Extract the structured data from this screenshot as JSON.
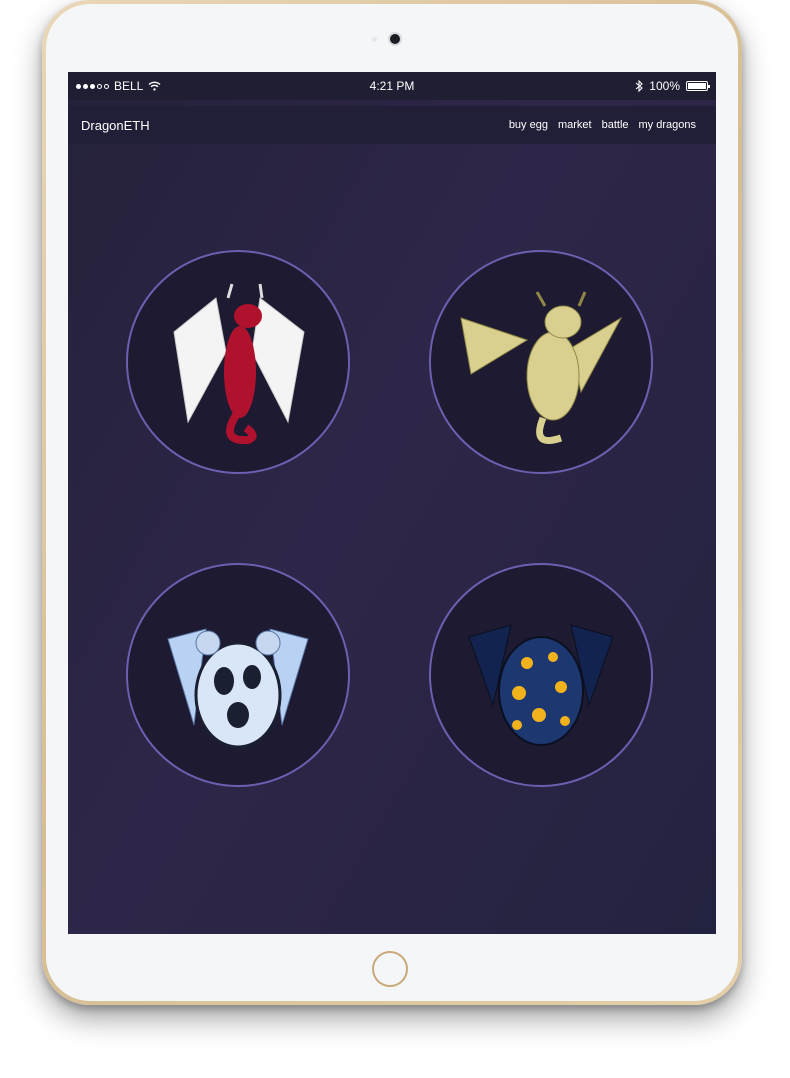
{
  "status_bar": {
    "carrier": "BELL",
    "time": "4:21 PM",
    "battery": "100%"
  },
  "nav": {
    "brand": "DragonETH",
    "links": [
      "buy egg",
      "market",
      "battle",
      "my dragons"
    ]
  },
  "dragons": [
    {
      "name": "red-dragon",
      "colors": {
        "body": "#b0122e",
        "wing": "#ffffff"
      }
    },
    {
      "name": "yellow-dragon",
      "colors": {
        "body": "#d9d08f",
        "wing": "#c7bd6f"
      }
    },
    {
      "name": "ice-egg-dragon",
      "colors": {
        "body": "#b9d1f2",
        "egg": "#d9e6f8"
      }
    },
    {
      "name": "navy-egg-dragon",
      "colors": {
        "body": "#13234f",
        "egg": "#1d3770",
        "spots": "#f2b21c"
      }
    }
  ],
  "colors": {
    "device_frame": "#dcc59c",
    "screen_bg": "#2a2444",
    "circle_border": "#6d5fb0",
    "circle_bg": "#1d1a31"
  }
}
